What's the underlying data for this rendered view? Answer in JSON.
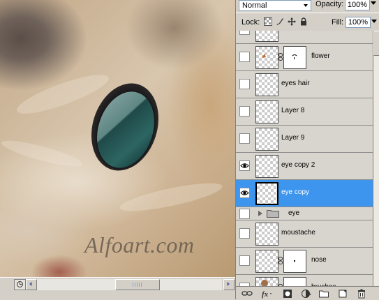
{
  "canvas": {
    "watermark": "Alfoart.com"
  },
  "panel": {
    "blend_mode": "Normal",
    "opacity_label": "Opacity:",
    "opacity_value": "100%",
    "lock_label": "Lock:",
    "fill_label": "Fill:",
    "fill_value": "100%",
    "layers": [
      {
        "name": "",
        "visible": false
      },
      {
        "name": "flower",
        "visible": false,
        "has_mask": true
      },
      {
        "name": "eyes hair",
        "visible": false
      },
      {
        "name": "Layer 8",
        "visible": false
      },
      {
        "name": "Layer 9",
        "visible": false
      },
      {
        "name": "eye copy 2",
        "visible": true
      },
      {
        "name": "eye copy",
        "visible": true,
        "selected": true
      },
      {
        "name": "eye",
        "visible": false,
        "is_group": true
      },
      {
        "name": "moustache",
        "visible": false
      },
      {
        "name": "nose",
        "visible": false,
        "has_mask": true
      },
      {
        "name": "brushes",
        "visible": false,
        "has_mask": true
      }
    ]
  },
  "colors": {
    "selection": "#3d95ee",
    "panel_bg": "#d4d0c8"
  }
}
